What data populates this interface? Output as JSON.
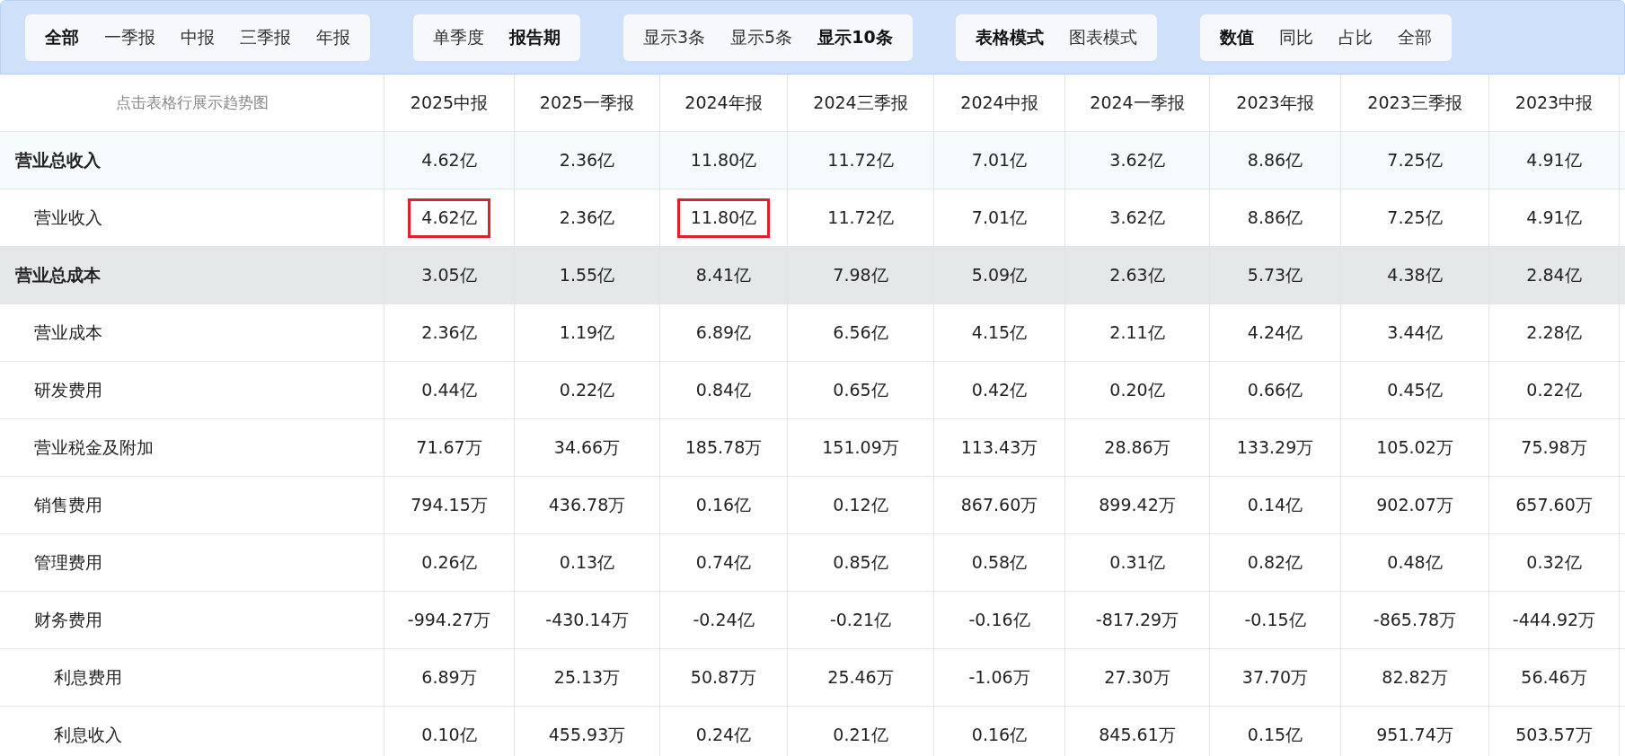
{
  "filter_groups": [
    {
      "options": [
        {
          "label": "全部",
          "selected": true
        },
        {
          "label": "一季报",
          "selected": false
        },
        {
          "label": "中报",
          "selected": false
        },
        {
          "label": "三季报",
          "selected": false
        },
        {
          "label": "年报",
          "selected": false
        }
      ]
    },
    {
      "options": [
        {
          "label": "单季度",
          "selected": false
        },
        {
          "label": "报告期",
          "selected": true
        }
      ]
    },
    {
      "options": [
        {
          "label": "显示3条",
          "selected": false
        },
        {
          "label": "显示5条",
          "selected": false
        },
        {
          "label": "显示10条",
          "selected": true
        }
      ]
    },
    {
      "options": [
        {
          "label": "表格模式",
          "selected": true
        },
        {
          "label": "图表模式",
          "selected": false
        }
      ]
    },
    {
      "options": [
        {
          "label": "数值",
          "selected": true
        },
        {
          "label": "同比",
          "selected": false
        },
        {
          "label": "占比",
          "selected": false
        },
        {
          "label": "全部",
          "selected": false
        }
      ]
    }
  ],
  "table": {
    "hint": "点击表格行展示趋势图",
    "columns": [
      "2025中报",
      "2025一季报",
      "2024年报",
      "2024三季报",
      "2024中报",
      "2024一季报",
      "2023年报",
      "2023三季报",
      "2023中报"
    ],
    "rows": [
      {
        "kind": "total",
        "label": "营业总收入",
        "cells": [
          {
            "text": "4.62亿",
            "highlighted": false
          },
          {
            "text": "2.36亿",
            "highlighted": false
          },
          {
            "text": "11.80亿",
            "highlighted": false
          },
          {
            "text": "11.72亿",
            "highlighted": false
          },
          {
            "text": "7.01亿",
            "highlighted": false
          },
          {
            "text": "3.62亿",
            "highlighted": false
          },
          {
            "text": "8.86亿",
            "highlighted": false
          },
          {
            "text": "7.25亿",
            "highlighted": false
          },
          {
            "text": "4.91亿",
            "highlighted": false
          }
        ]
      },
      {
        "kind": "item",
        "label": "营业收入",
        "cells": [
          {
            "text": "4.62亿",
            "highlighted": true
          },
          {
            "text": "2.36亿",
            "highlighted": false
          },
          {
            "text": "11.80亿",
            "highlighted": true
          },
          {
            "text": "11.72亿",
            "highlighted": false
          },
          {
            "text": "7.01亿",
            "highlighted": false
          },
          {
            "text": "3.62亿",
            "highlighted": false
          },
          {
            "text": "8.86亿",
            "highlighted": false
          },
          {
            "text": "7.25亿",
            "highlighted": false
          },
          {
            "text": "4.91亿",
            "highlighted": false
          }
        ]
      },
      {
        "kind": "group",
        "label": "营业总成本",
        "cells": [
          {
            "text": "3.05亿",
            "highlighted": false
          },
          {
            "text": "1.55亿",
            "highlighted": false
          },
          {
            "text": "8.41亿",
            "highlighted": false
          },
          {
            "text": "7.98亿",
            "highlighted": false
          },
          {
            "text": "5.09亿",
            "highlighted": false
          },
          {
            "text": "2.63亿",
            "highlighted": false
          },
          {
            "text": "5.73亿",
            "highlighted": false
          },
          {
            "text": "4.38亿",
            "highlighted": false
          },
          {
            "text": "2.84亿",
            "highlighted": false
          }
        ]
      },
      {
        "kind": "item",
        "label": "营业成本",
        "cells": [
          {
            "text": "2.36亿",
            "highlighted": false
          },
          {
            "text": "1.19亿",
            "highlighted": false
          },
          {
            "text": "6.89亿",
            "highlighted": false
          },
          {
            "text": "6.56亿",
            "highlighted": false
          },
          {
            "text": "4.15亿",
            "highlighted": false
          },
          {
            "text": "2.11亿",
            "highlighted": false
          },
          {
            "text": "4.24亿",
            "highlighted": false
          },
          {
            "text": "3.44亿",
            "highlighted": false
          },
          {
            "text": "2.28亿",
            "highlighted": false
          }
        ]
      },
      {
        "kind": "item",
        "label": "研发费用",
        "cells": [
          {
            "text": "0.44亿",
            "highlighted": false
          },
          {
            "text": "0.22亿",
            "highlighted": false
          },
          {
            "text": "0.84亿",
            "highlighted": false
          },
          {
            "text": "0.65亿",
            "highlighted": false
          },
          {
            "text": "0.42亿",
            "highlighted": false
          },
          {
            "text": "0.20亿",
            "highlighted": false
          },
          {
            "text": "0.66亿",
            "highlighted": false
          },
          {
            "text": "0.45亿",
            "highlighted": false
          },
          {
            "text": "0.22亿",
            "highlighted": false
          }
        ]
      },
      {
        "kind": "item",
        "label": "营业税金及附加",
        "cells": [
          {
            "text": "71.67万",
            "highlighted": false
          },
          {
            "text": "34.66万",
            "highlighted": false
          },
          {
            "text": "185.78万",
            "highlighted": false
          },
          {
            "text": "151.09万",
            "highlighted": false
          },
          {
            "text": "113.43万",
            "highlighted": false
          },
          {
            "text": "28.86万",
            "highlighted": false
          },
          {
            "text": "133.29万",
            "highlighted": false
          },
          {
            "text": "105.02万",
            "highlighted": false
          },
          {
            "text": "75.98万",
            "highlighted": false
          }
        ]
      },
      {
        "kind": "item",
        "label": "销售费用",
        "cells": [
          {
            "text": "794.15万",
            "highlighted": false
          },
          {
            "text": "436.78万",
            "highlighted": false
          },
          {
            "text": "0.16亿",
            "highlighted": false
          },
          {
            "text": "0.12亿",
            "highlighted": false
          },
          {
            "text": "867.60万",
            "highlighted": false
          },
          {
            "text": "899.42万",
            "highlighted": false
          },
          {
            "text": "0.14亿",
            "highlighted": false
          },
          {
            "text": "902.07万",
            "highlighted": false
          },
          {
            "text": "657.60万",
            "highlighted": false
          }
        ]
      },
      {
        "kind": "item",
        "label": "管理费用",
        "cells": [
          {
            "text": "0.26亿",
            "highlighted": false
          },
          {
            "text": "0.13亿",
            "highlighted": false
          },
          {
            "text": "0.74亿",
            "highlighted": false
          },
          {
            "text": "0.85亿",
            "highlighted": false
          },
          {
            "text": "0.58亿",
            "highlighted": false
          },
          {
            "text": "0.31亿",
            "highlighted": false
          },
          {
            "text": "0.82亿",
            "highlighted": false
          },
          {
            "text": "0.48亿",
            "highlighted": false
          },
          {
            "text": "0.32亿",
            "highlighted": false
          }
        ]
      },
      {
        "kind": "item",
        "label": "财务费用",
        "cells": [
          {
            "text": "-994.27万",
            "highlighted": false
          },
          {
            "text": "-430.14万",
            "highlighted": false
          },
          {
            "text": "-0.24亿",
            "highlighted": false
          },
          {
            "text": "-0.21亿",
            "highlighted": false
          },
          {
            "text": "-0.16亿",
            "highlighted": false
          },
          {
            "text": "-817.29万",
            "highlighted": false
          },
          {
            "text": "-0.15亿",
            "highlighted": false
          },
          {
            "text": "-865.78万",
            "highlighted": false
          },
          {
            "text": "-444.92万",
            "highlighted": false
          }
        ]
      },
      {
        "kind": "subitem",
        "label": "利息费用",
        "cells": [
          {
            "text": "6.89万",
            "highlighted": false
          },
          {
            "text": "25.13万",
            "highlighted": false
          },
          {
            "text": "50.87万",
            "highlighted": false
          },
          {
            "text": "25.46万",
            "highlighted": false
          },
          {
            "text": "-1.06万",
            "highlighted": false
          },
          {
            "text": "27.30万",
            "highlighted": false
          },
          {
            "text": "37.70万",
            "highlighted": false
          },
          {
            "text": "82.82万",
            "highlighted": false
          },
          {
            "text": "56.46万",
            "highlighted": false
          }
        ]
      },
      {
        "kind": "subitem",
        "label": "利息收入",
        "cells": [
          {
            "text": "0.10亿",
            "highlighted": false
          },
          {
            "text": "455.93万",
            "highlighted": false
          },
          {
            "text": "0.24亿",
            "highlighted": false
          },
          {
            "text": "0.21亿",
            "highlighted": false
          },
          {
            "text": "0.16亿",
            "highlighted": false
          },
          {
            "text": "845.61万",
            "highlighted": false
          },
          {
            "text": "0.15亿",
            "highlighted": false
          },
          {
            "text": "951.74万",
            "highlighted": false
          },
          {
            "text": "503.57万",
            "highlighted": false
          }
        ]
      }
    ]
  }
}
